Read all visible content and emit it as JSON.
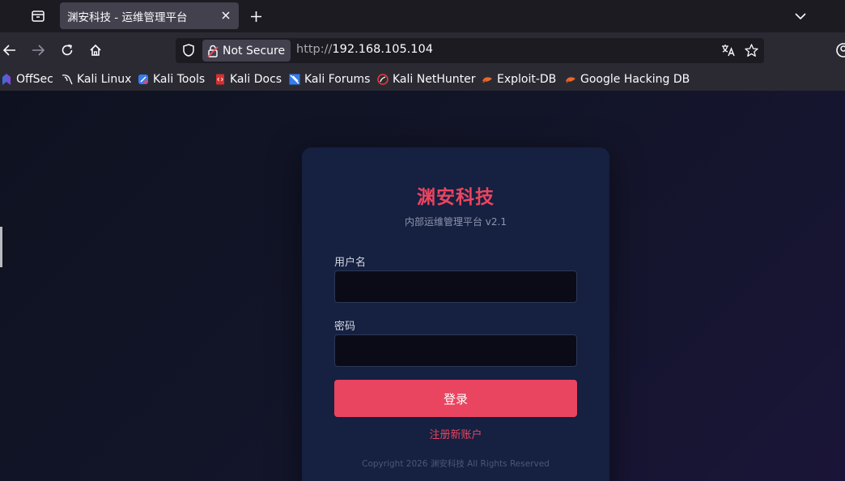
{
  "browser": {
    "tab_title": "渊安科技 - 运维管理平台",
    "secure_label": "Not Secure",
    "url_protocol": "http://",
    "url_host": "192.168.105.104"
  },
  "bookmarks": [
    {
      "label": "OffSec",
      "icon": "offsec-icon"
    },
    {
      "label": "Kali Linux",
      "icon": "kali-dragon-icon"
    },
    {
      "label": "Kali Tools",
      "icon": "kali-tools-icon"
    },
    {
      "label": "Kali Docs",
      "icon": "kali-docs-icon"
    },
    {
      "label": "Kali Forums",
      "icon": "kali-forums-icon"
    },
    {
      "label": "Kali NetHunter",
      "icon": "nethunter-icon"
    },
    {
      "label": "Exploit-DB",
      "icon": "exploit-db-icon"
    },
    {
      "label": "Google Hacking DB",
      "icon": "ghdb-icon"
    }
  ],
  "login": {
    "brand": "渊安科技",
    "subtitle": "内部运维管理平台 v2.1",
    "username_label": "用户名",
    "username_value": "",
    "password_label": "密码",
    "password_value": "",
    "login_button": "登录",
    "register_link": "注册新账户",
    "copyright": "Copyright 2026 渊安科技 All Rights Reserved"
  },
  "colors": {
    "accent": "#e94560",
    "card": "#162040",
    "input_bg": "#0b0b17"
  }
}
